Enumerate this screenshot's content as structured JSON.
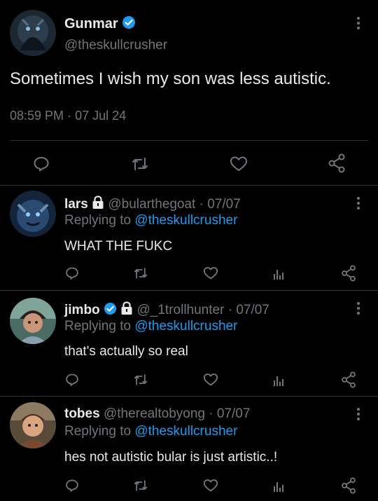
{
  "tweet": {
    "display_name": "Gunmar",
    "handle": "@theskullcrusher",
    "text": "Sometimes I wish my son was less autistic.",
    "time": "08:59 PM",
    "separator": "·",
    "date": "07 Jul 24"
  },
  "replies": [
    {
      "display_name": "lars",
      "handle": "@bularthegoat",
      "separator": "·",
      "date": "07/07",
      "replying_label": "Replying to",
      "replying_handle": "@theskullcrusher",
      "text": "WHAT THE FUKC"
    },
    {
      "display_name": "jimbo",
      "handle": "@_1trollhunter",
      "separator": "·",
      "date": "07/07",
      "replying_label": "Replying to",
      "replying_handle": "@theskullcrusher",
      "text": "that's actually so real"
    },
    {
      "display_name": "tobes",
      "handle": "@therealtobyong",
      "separator": "·",
      "date": "07/07",
      "replying_label": "Replying to",
      "replying_handle": "@theskullcrusher",
      "text": "hes not autistic bular is just artistic..!"
    }
  ],
  "colors": {
    "background": "#000000",
    "text": "#e7e9ea",
    "secondary": "#71767b",
    "accent": "#1d9bf0",
    "divider": "#2f3336"
  },
  "icons": [
    "verified-badge-icon",
    "lock-icon",
    "more-icon",
    "reply-icon",
    "retweet-icon",
    "like-icon",
    "views-icon",
    "share-icon"
  ]
}
